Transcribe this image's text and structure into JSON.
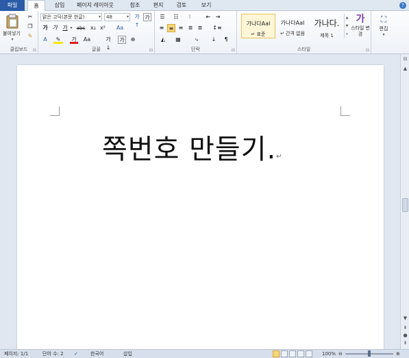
{
  "tabs": [
    "파일",
    "홈",
    "삽입",
    "페이지 레이아웃",
    "참조",
    "편지",
    "검토",
    "보기"
  ],
  "help_label": "?",
  "clipboard": {
    "paste_label": "붙여넣기",
    "paste_arrow": "▾",
    "group_label": "클립보드",
    "launcher": "⊡"
  },
  "font": {
    "font_name": "맑은 고딕(본문 한글)",
    "font_size": "48",
    "bold": "가",
    "italic": "가",
    "underline": "가",
    "strike": "abc",
    "subscript": "x₂",
    "superscript": "x²",
    "text_color": "가",
    "font_size_menu": "Aa",
    "group_label": "글꼴",
    "launcher": "⊡"
  },
  "paragraph": {
    "group_label": "단락",
    "launcher": "⊡"
  },
  "styles": {
    "items": [
      {
        "preview": "가나다AaI",
        "name": "↵ 표준"
      },
      {
        "preview": "가나다AaI",
        "name": "↵ 간격 없음"
      },
      {
        "preview": "가나다.",
        "name": "제목 1"
      }
    ],
    "change_label": "스타일 변경",
    "group_label": "스타일",
    "launcher": "⊡"
  },
  "editing": {
    "label": "편집"
  },
  "document": {
    "text": "쪽번호 만들기.",
    "paragraph_mark": "↵"
  },
  "status": {
    "page": "페이지: 1/1",
    "words": "단어 수: 2",
    "language": "한국어",
    "mode": "삽입",
    "zoom": "100%"
  }
}
